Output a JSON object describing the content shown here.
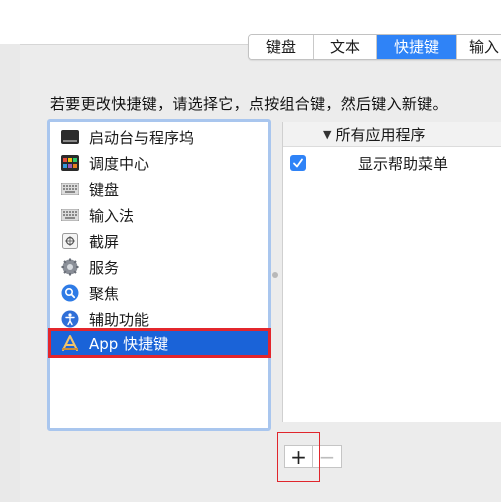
{
  "tabs": [
    {
      "label": "键盘",
      "active": false
    },
    {
      "label": "文本",
      "active": false
    },
    {
      "label": "快捷键",
      "active": true
    },
    {
      "label": "输入",
      "active": false
    }
  ],
  "instruction": "若要更改快捷键，请选择它，点按组合键，然后键入新键。",
  "categories": [
    {
      "label": "启动台与程序坞",
      "icon": "launchpad-dock-icon"
    },
    {
      "label": "调度中心",
      "icon": "mission-control-icon"
    },
    {
      "label": "键盘",
      "icon": "keyboard-icon"
    },
    {
      "label": "输入法",
      "icon": "input-source-icon"
    },
    {
      "label": "截屏",
      "icon": "screenshot-icon"
    },
    {
      "label": "服务",
      "icon": "services-gear-icon"
    },
    {
      "label": "聚焦",
      "icon": "spotlight-icon"
    },
    {
      "label": "辅助功能",
      "icon": "accessibility-icon"
    },
    {
      "label": "App 快捷键",
      "icon": "app-store-icon",
      "selected": true
    }
  ],
  "shortcuts": {
    "group_label": "所有应用程序",
    "rows": [
      {
        "label": "显示帮助菜单",
        "checked": true
      }
    ]
  },
  "buttons": {
    "add": "+",
    "remove": "−"
  },
  "colors": {
    "accent": "#2f83f7",
    "selection": "#1a63d8",
    "annotation_red": "#e3262c"
  }
}
